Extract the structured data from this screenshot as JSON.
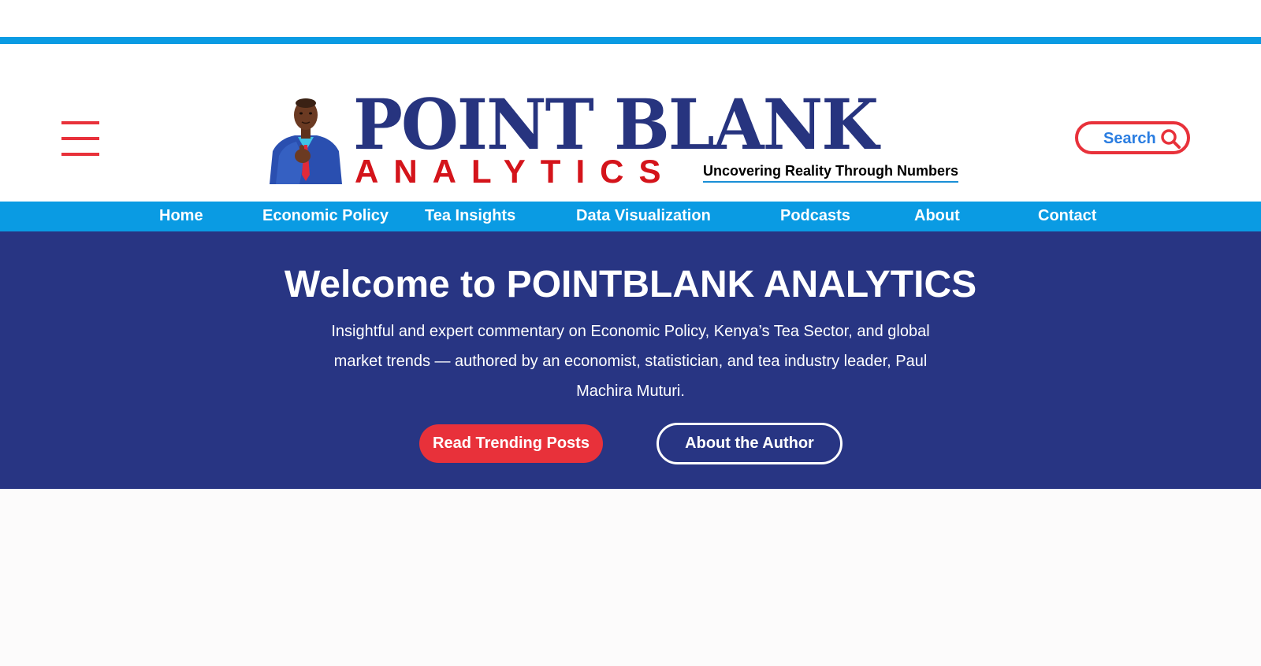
{
  "colors": {
    "brand_blue": "#27347f",
    "accent_cyan": "#0a9be3",
    "accent_red": "#e8313a",
    "hero_bg": "#283583",
    "search_text": "#2a7de1"
  },
  "header": {
    "menu_icon": "hamburger-menu-icon",
    "logo": {
      "title": "POINT BLANK",
      "subtitle": "ANALYTICS",
      "tagline": "Uncovering Reality Through Numbers"
    },
    "search": {
      "label": "Search",
      "icon": "search-icon"
    }
  },
  "nav": {
    "items": [
      {
        "label": "Home"
      },
      {
        "label": "Economic Policy"
      },
      {
        "label": "Tea Insights"
      },
      {
        "label": "Data Visualization"
      },
      {
        "label": "Podcasts"
      },
      {
        "label": "About"
      },
      {
        "label": "Contact"
      }
    ]
  },
  "hero": {
    "title": "Welcome to POINTBLANK ANALYTICS",
    "description": "Insightful and expert commentary on Economic Policy, Kenya’s Tea Sector, and global market trends — authored by an economist, statistician, and tea industry leader, Paul Machira Muturi.",
    "primary_button": "Read Trending Posts",
    "secondary_button": "About the Author"
  }
}
